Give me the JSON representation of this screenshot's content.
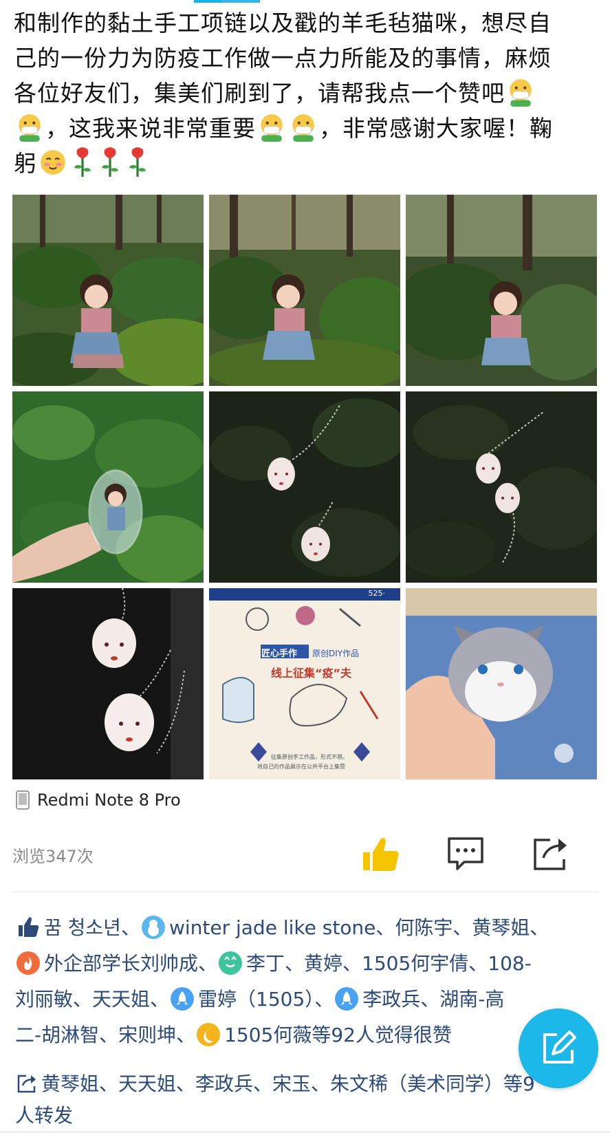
{
  "post": {
    "line1": "和制作的黏土手工项链以及戳的羊毛毡猫咪，想尽自",
    "line2": "己的一份力为防疫工作做一点力所能及的事情，麻烦",
    "line3": "各位好友们，集美们刷到了，请帮我点一个赞吧",
    "line4a": "，这我来说非常重要",
    "line4b": "，非常感谢大家喔！鞠",
    "line5": "躬"
  },
  "photos": [
    {
      "label": "doll-forest-1"
    },
    {
      "label": "doll-forest-2"
    },
    {
      "label": "doll-forest-3"
    },
    {
      "label": "doll-in-capsule"
    },
    {
      "label": "clay-necklaces-dark-1"
    },
    {
      "label": "clay-necklaces-dark-2"
    },
    {
      "label": "clay-necklaces-black-cloth"
    },
    {
      "label": "poster",
      "poster_text": {
        "banner": "匠心手作",
        "subtitle": "原创DIY作品",
        "headline": "线上征集“疫”夫",
        "top": "525·",
        "footer1": "征集原创手工作品，形式不限。",
        "footer2": "将自己的作品展示在公共平台上集赞"
      }
    },
    {
      "label": "wool-felt-cat"
    }
  ],
  "device": {
    "label": "Redmi Note 8 Pro",
    "icon": "phone-icon"
  },
  "stats": {
    "views": "浏览347次"
  },
  "actions": {
    "like_icon": "thumbs-up-icon",
    "comment_icon": "comment-icon",
    "share_icon": "share-icon"
  },
  "likes": {
    "n1": "꿈 청소년、",
    "n2": "winter jade like stone、何陈宇、黄琴姐、",
    "n3": "外企部学长刘帅成、",
    "n4": "李丁、黄婷、1505何宇倩、108-",
    "n5": "刘丽敏、天天姐、",
    "n6": "雷婷（1505）、",
    "n7": "李政兵、湖南-高",
    "n8": "二-胡淋智、宋则坤、",
    "n9": "1505何薇等92人觉得很赞"
  },
  "shares": {
    "line1": "黄琴姐、天天姐、李政兵、宋玉、朱文稀（美术同学）等9",
    "line2": "人转发"
  },
  "colors": {
    "accent": "#1cb8ea",
    "name_link": "#2c4a7a",
    "like_yellow": "#f5c400"
  }
}
